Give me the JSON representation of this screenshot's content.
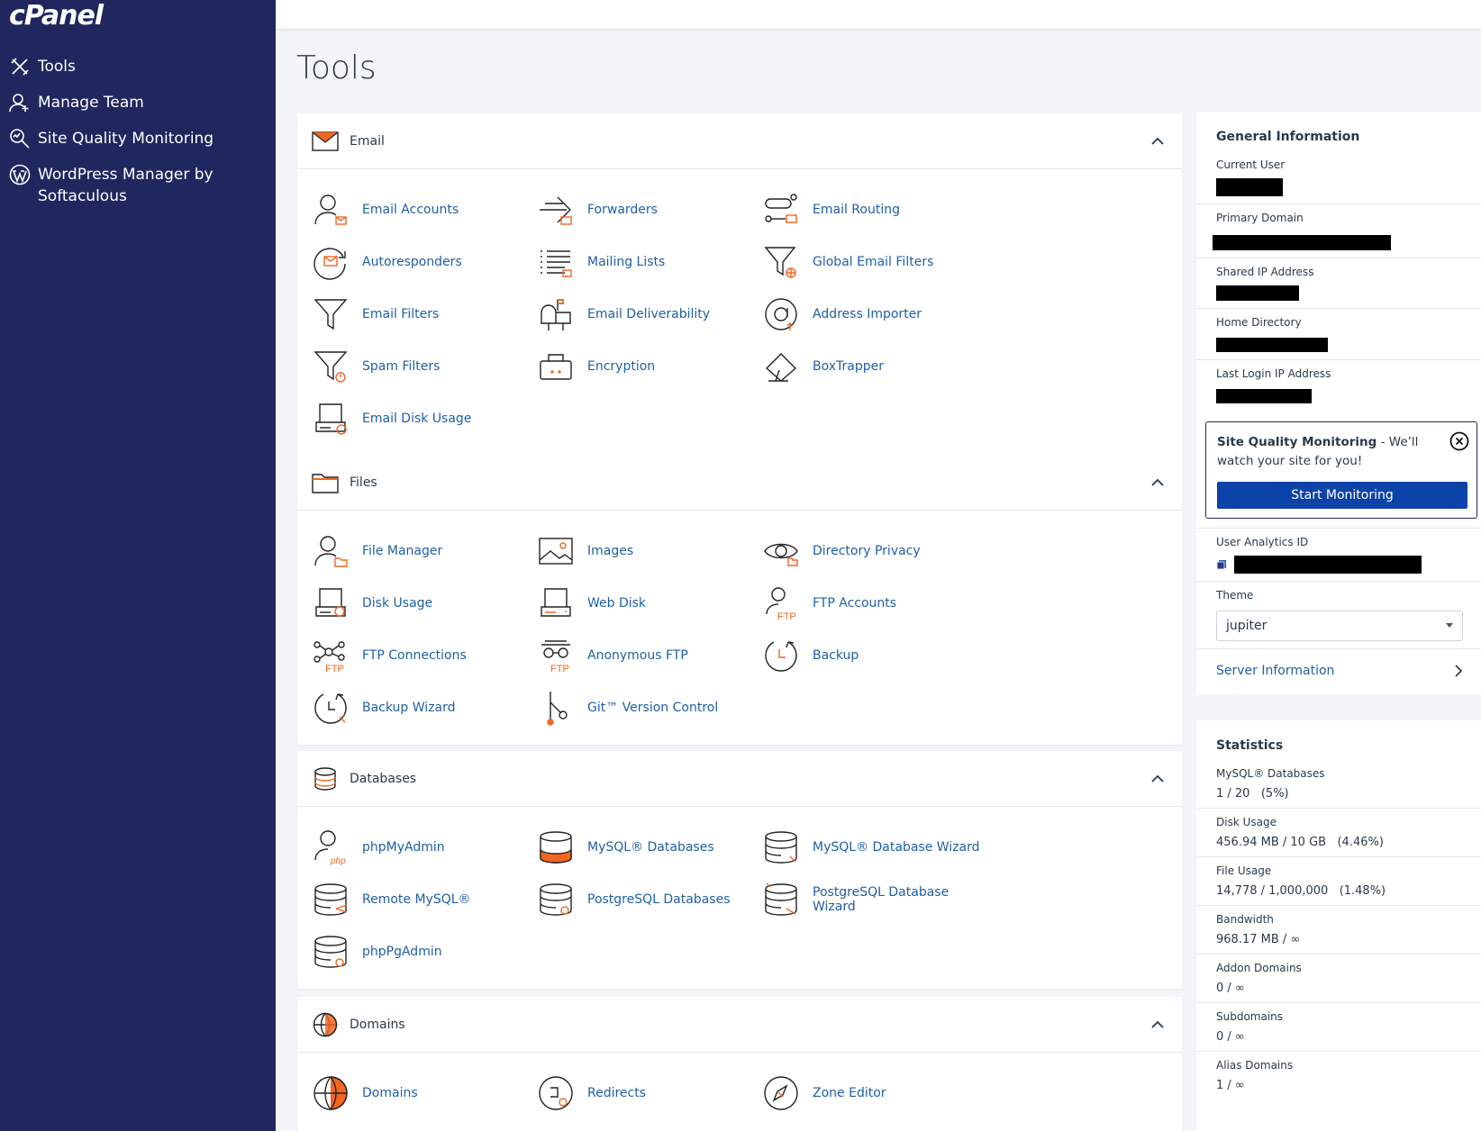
{
  "brand": {
    "logo": "cPanel"
  },
  "sidebar": {
    "items": [
      {
        "label": "Tools",
        "icon": "tools-icon"
      },
      {
        "label": "Manage Team",
        "icon": "team-icon"
      },
      {
        "label": "Site Quality Monitoring",
        "icon": "monitor-search-icon"
      },
      {
        "label": "WordPress Manager by Softaculous",
        "icon": "wordpress-icon"
      }
    ]
  },
  "page": {
    "title": "Tools"
  },
  "sections": {
    "email": {
      "title": "Email",
      "tools": [
        "Email Accounts",
        "Forwarders",
        "Email Routing",
        "Autoresponders",
        "Mailing Lists",
        "Global Email Filters",
        "Email Filters",
        "Email Deliverability",
        "Address Importer",
        "Spam Filters",
        "Encryption",
        "BoxTrapper",
        "Email Disk Usage"
      ]
    },
    "files": {
      "title": "Files",
      "tools": [
        "File Manager",
        "Images",
        "Directory Privacy",
        "Disk Usage",
        "Web Disk",
        "FTP Accounts",
        "FTP Connections",
        "Anonymous FTP",
        "Backup",
        "Backup Wizard",
        "Git™ Version Control"
      ]
    },
    "databases": {
      "title": "Databases",
      "tools": [
        "phpMyAdmin",
        "MySQL® Databases",
        "MySQL® Database Wizard",
        "Remote MySQL®",
        "PostgreSQL Databases",
        "PostgreSQL Database Wizard",
        "phpPgAdmin"
      ]
    },
    "domains": {
      "title": "Domains",
      "tools": [
        "Domains",
        "Redirects",
        "Zone Editor"
      ]
    }
  },
  "general_info": {
    "title": "General Information",
    "current_user_label": "Current User",
    "primary_domain_label": "Primary Domain",
    "shared_ip_label": "Shared IP Address",
    "home_dir_label": "Home Directory",
    "last_login_label": "Last Login IP Address",
    "sqm": {
      "bold": "Site Quality Monitoring",
      "text": " - We’ll watch your site for you!",
      "button": "Start Monitoring"
    },
    "analytics_label": "User Analytics ID",
    "theme_label": "Theme",
    "theme_value": "jupiter",
    "server_info": "Server Information"
  },
  "statistics": {
    "title": "Statistics",
    "rows": [
      {
        "label": "MySQL® Databases",
        "value": "1 / 20   (5%)"
      },
      {
        "label": "Disk Usage",
        "value": "456.94 MB / 10 GB   (4.46%)"
      },
      {
        "label": "File Usage",
        "value": "14,778 / 1,000,000   (1.48%)"
      },
      {
        "label": "Bandwidth",
        "value": "968.17 MB / ∞"
      },
      {
        "label": "Addon Domains",
        "value": "0 / ∞"
      },
      {
        "label": "Subdomains",
        "value": "0 / ∞"
      },
      {
        "label": "Alias Domains",
        "value": "1 / ∞"
      }
    ]
  },
  "colors": {
    "sidebar": "#20275e",
    "link": "#1f5fa6",
    "accent": "#f26522",
    "button": "#0b43a8"
  }
}
